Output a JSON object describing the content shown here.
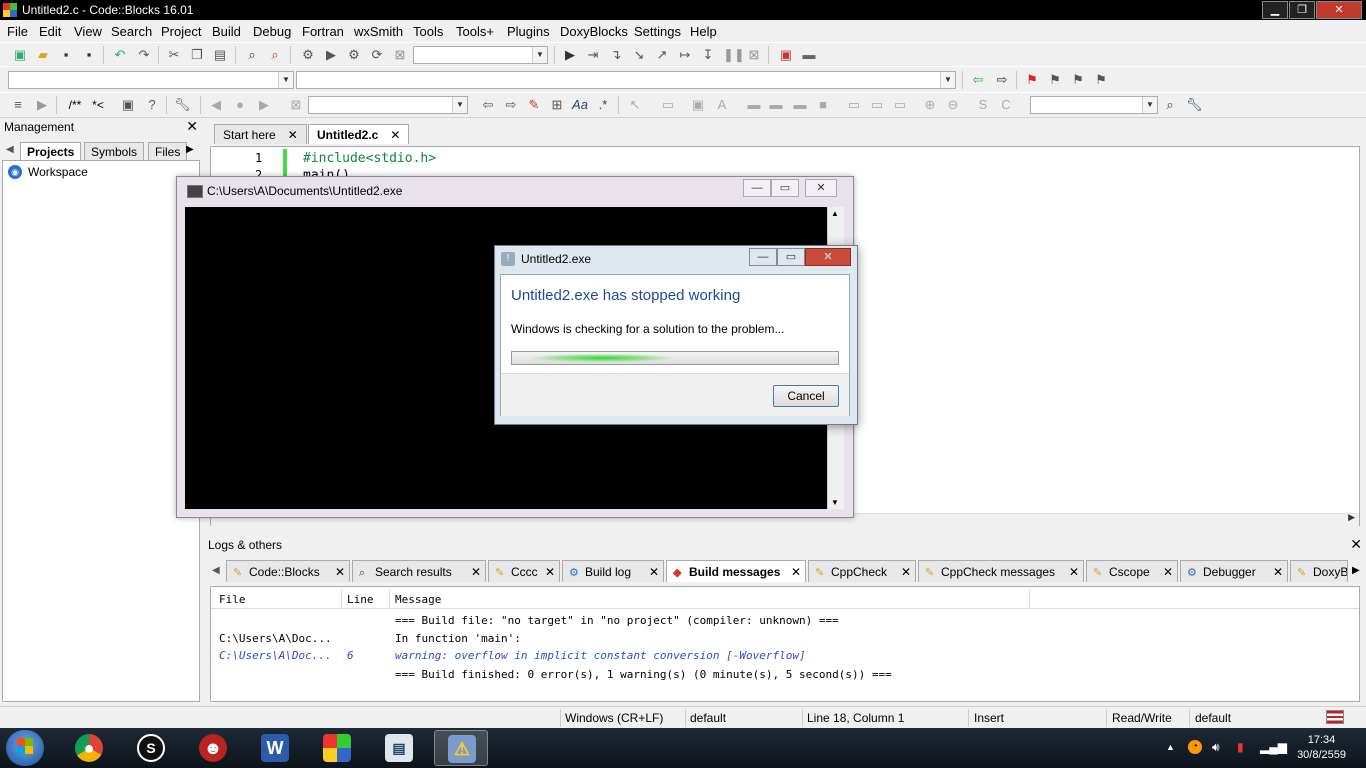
{
  "window": {
    "title": "Untitled2.c - Code::Blocks 16.01",
    "controls": {
      "minimize": "▁",
      "restore": "❐",
      "close": "✕"
    }
  },
  "menu": [
    "File",
    "Edit",
    "View",
    "Search",
    "Project",
    "Build",
    "Debug",
    "Fortran",
    "wxSmith",
    "Tools",
    "Tools+",
    "Plugins",
    "DoxyBlocks",
    "Settings",
    "Help"
  ],
  "toolbar": {
    "row1_icons": [
      "new-file",
      "open",
      "save",
      "save-all",
      "undo",
      "redo",
      "cut",
      "copy",
      "paste",
      "find",
      "replace",
      "settings",
      "run",
      "build",
      "rebuild",
      "abort",
      "debug",
      "step",
      "step-into",
      "step-out",
      "next",
      "pause",
      "stop",
      "info",
      "window"
    ],
    "row3_comment_labels": [
      "/**",
      "*<"
    ]
  },
  "management": {
    "title": "Management",
    "close": "✕",
    "tabs": [
      "Projects",
      "Symbols",
      "Files"
    ],
    "tree_root": "Workspace"
  },
  "editor": {
    "tabs": [
      {
        "label": "Start here",
        "close": "✕"
      },
      {
        "label": "Untitled2.c",
        "close": "✕"
      }
    ],
    "lines": [
      {
        "num": "1",
        "code": "#include<stdio.h>"
      },
      {
        "num": "2",
        "code": "main()"
      }
    ]
  },
  "console": {
    "title": "C:\\Users\\A\\Documents\\Untitled2.exe",
    "controls": {
      "minimize": "—",
      "restore": "▭",
      "close": "✕"
    }
  },
  "dialog": {
    "title": "Untitled2.exe",
    "heading": "Untitled2.exe has stopped working",
    "message": "Windows is checking for a solution to the problem...",
    "cancel": "Cancel",
    "controls": {
      "minimize": "—",
      "restore": "▭",
      "close": "✕"
    }
  },
  "logs": {
    "title": "Logs & others",
    "close": "✕",
    "tabs": [
      "Code::Blocks",
      "Search results",
      "Cccc",
      "Build log",
      "Build messages",
      "CppCheck",
      "CppCheck messages",
      "Cscope",
      "Debugger",
      "DoxyB"
    ],
    "active_tab": "Build messages",
    "columns": [
      "File",
      "Line",
      "Message"
    ],
    "rows": [
      {
        "file": "",
        "line": "",
        "message": "=== Build file: \"no target\" in \"no project\" (compiler: unknown) ===",
        "warning": false
      },
      {
        "file": "C:\\Users\\A\\Doc...",
        "line": "",
        "message": "In function 'main':",
        "warning": false
      },
      {
        "file": "C:\\Users\\A\\Doc...",
        "line": "6",
        "message": "warning: overflow in implicit constant conversion [-Woverflow]",
        "warning": true
      },
      {
        "file": "",
        "line": "",
        "message": "=== Build finished: 0 error(s), 1 warning(s) (0 minute(s), 5 second(s)) ===",
        "warning": false
      }
    ]
  },
  "status": {
    "eol": "Windows (CR+LF)",
    "encoding": "default",
    "position": "Line 18, Column 1",
    "mode": "Insert",
    "access": "Read/Write",
    "lang": "default"
  },
  "taskbar": {
    "time": "17:34",
    "date": "30/8/2559"
  },
  "colors": {
    "accent": "#1e4a9b",
    "warning": "#2a4bd7",
    "gutter_change": "#44dd44"
  }
}
